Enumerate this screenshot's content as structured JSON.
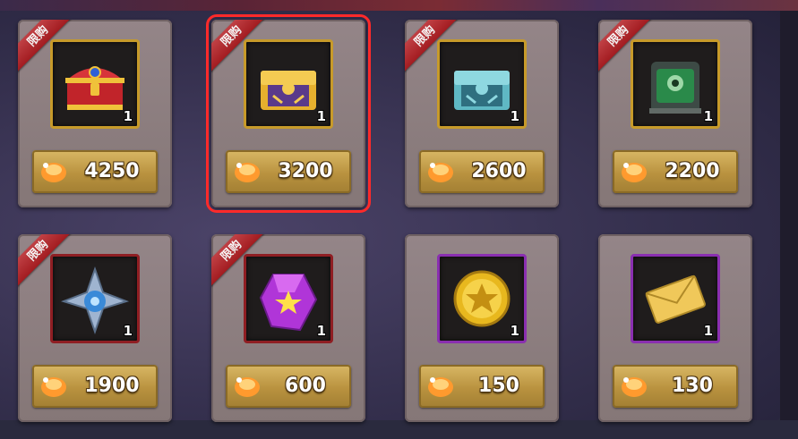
{
  "shop": {
    "items": [
      {
        "name": "red-treasure-chest",
        "ribbon": "限购",
        "qty": "1",
        "price": "4250",
        "frame": "gold"
      },
      {
        "name": "gold-purple-chest",
        "ribbon": "限购",
        "qty": "1",
        "price": "3200",
        "frame": "gold",
        "selected": true
      },
      {
        "name": "teal-chest",
        "ribbon": "限购",
        "qty": "1",
        "price": "2600",
        "frame": "gold"
      },
      {
        "name": "green-mech-chest",
        "ribbon": "限购",
        "qty": "1",
        "price": "2200",
        "frame": "gold"
      },
      {
        "name": "blue-shuriken",
        "ribbon": "限购",
        "qty": "1",
        "price": "1900",
        "frame": "red"
      },
      {
        "name": "purple-crystal",
        "ribbon": "限购",
        "qty": "1",
        "price": "600",
        "frame": "red"
      },
      {
        "name": "gold-star-coin",
        "qty": "1",
        "price": "150",
        "frame": "purple"
      },
      {
        "name": "gold-envelope",
        "qty": "1",
        "price": "130",
        "frame": "purple"
      }
    ]
  },
  "colors": {
    "highlight": "#ff2a2a",
    "ribbon": "#b51f24",
    "price_bar": "#c9a650"
  }
}
